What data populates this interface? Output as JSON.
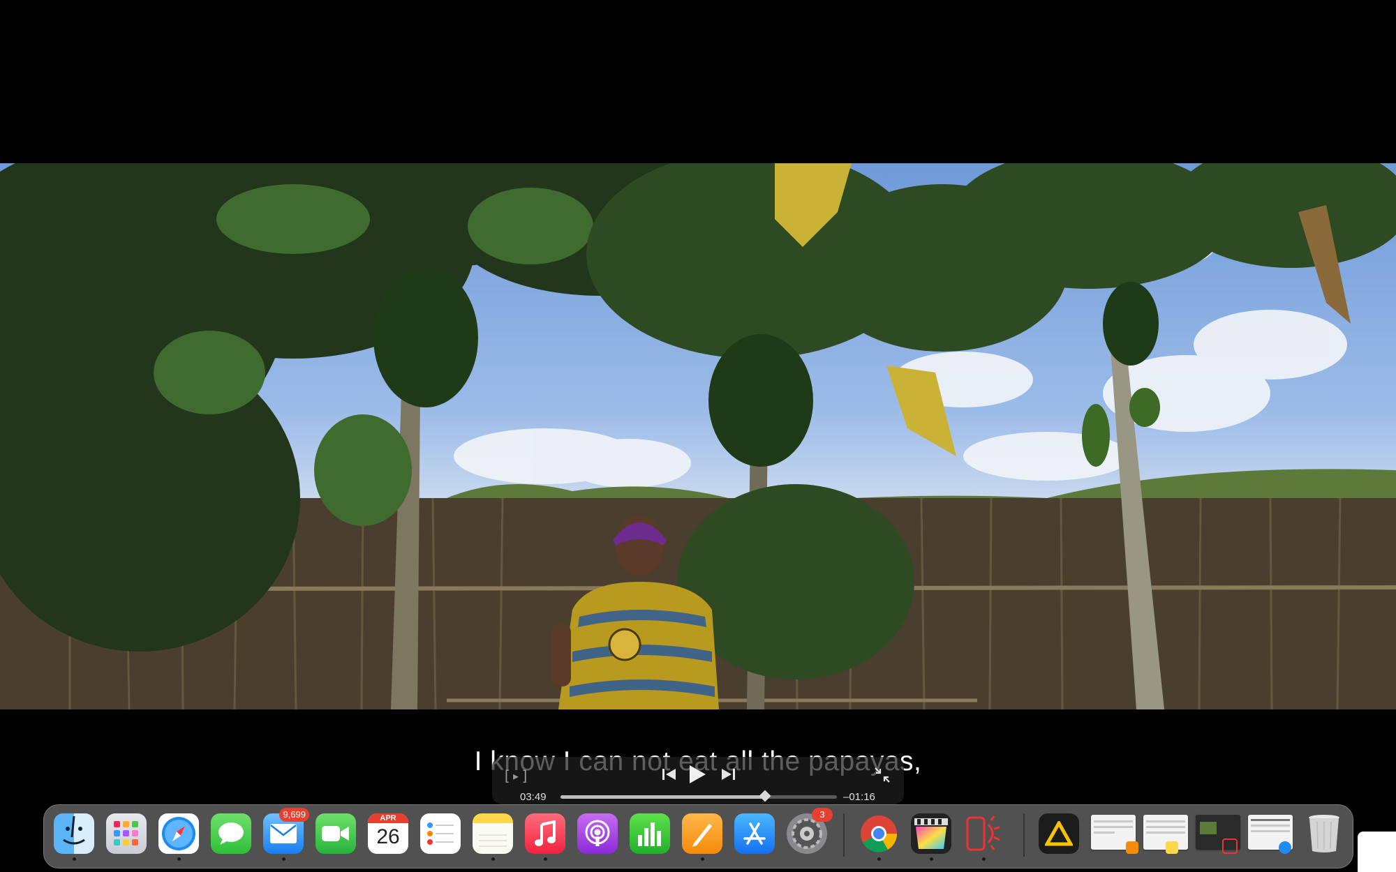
{
  "video": {
    "subtitle": "I know I can not eat all the papayas,",
    "time_elapsed": "03:49",
    "time_remaining": "–01:16",
    "progress": 0.74
  },
  "controls": {
    "subtitle_icon": "subtitles-icon",
    "prev_icon": "skip-back-icon",
    "play_icon": "play-icon",
    "next_icon": "skip-forward-icon",
    "exit_fullscreen_icon": "exit-fullscreen-icon",
    "subtitle_glyph": "[▸]"
  },
  "dock": {
    "apps": [
      {
        "name": "Finder",
        "icon": "finder-icon",
        "running": true
      },
      {
        "name": "Launchpad",
        "icon": "launchpad-icon",
        "running": false
      },
      {
        "name": "Safari",
        "icon": "safari-icon",
        "running": true
      },
      {
        "name": "Messages",
        "icon": "messages-icon",
        "running": false
      },
      {
        "name": "Mail",
        "icon": "mail-icon",
        "badge": "9,699",
        "running": true
      },
      {
        "name": "FaceTime",
        "icon": "facetime-icon",
        "running": false
      },
      {
        "name": "Calendar",
        "icon": "calendar-icon",
        "month": "APR",
        "day": "26",
        "running": false
      },
      {
        "name": "Reminders",
        "icon": "reminders-icon",
        "running": false
      },
      {
        "name": "Notes",
        "icon": "notes-icon",
        "running": true
      },
      {
        "name": "Music",
        "icon": "music-icon",
        "running": true
      },
      {
        "name": "Podcasts",
        "icon": "podcasts-icon",
        "running": false
      },
      {
        "name": "Numbers",
        "icon": "numbers-icon",
        "running": false
      },
      {
        "name": "Pages",
        "icon": "pages-icon",
        "running": true
      },
      {
        "name": "App Store",
        "icon": "app-store-icon",
        "running": false
      },
      {
        "name": "System Settings",
        "icon": "system-settings-icon",
        "badge": "3",
        "running": false
      },
      {
        "name": "Chrome",
        "icon": "chrome-icon",
        "running": true
      },
      {
        "name": "Final Cut Pro",
        "icon": "final-cut-icon",
        "running": true
      },
      {
        "name": "Simulator",
        "icon": "simulator-icon",
        "running": true
      },
      {
        "name": "Vectorworks",
        "icon": "triangle-app-icon",
        "running": false
      }
    ],
    "calendar_month": "APR",
    "calendar_day": "26",
    "mail_badge": "9,699",
    "settings_badge": "3"
  },
  "colors": {
    "badge": "#e8402f",
    "dock_bg": "#5f5f5f"
  }
}
